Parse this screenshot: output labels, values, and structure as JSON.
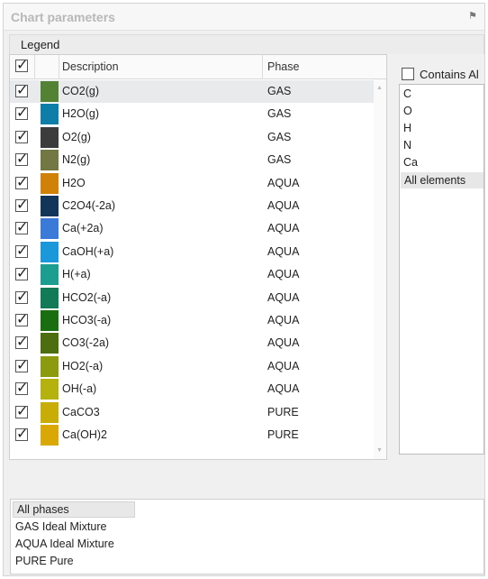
{
  "panel": {
    "title": "Chart parameters",
    "pin_glyph": "⚑"
  },
  "legend": {
    "label": "Legend"
  },
  "grid": {
    "columns": {
      "description": "Description",
      "phase": "Phase"
    },
    "rows": [
      {
        "description": "CO2(g)",
        "phase": "GAS",
        "color": "#548235"
      },
      {
        "description": "H2O(g)",
        "phase": "GAS",
        "color": "#0e7ea8"
      },
      {
        "description": "O2(g)",
        "phase": "GAS",
        "color": "#3c3c3c"
      },
      {
        "description": "N2(g)",
        "phase": "GAS",
        "color": "#727744"
      },
      {
        "description": "H2O",
        "phase": "AQUA",
        "color": "#d08108"
      },
      {
        "description": "C2O4(-2a)",
        "phase": "AQUA",
        "color": "#12365a"
      },
      {
        "description": "Ca(+2a)",
        "phase": "AQUA",
        "color": "#3b7ad8"
      },
      {
        "description": "CaOH(+a)",
        "phase": "AQUA",
        "color": "#1a98d9"
      },
      {
        "description": "H(+a)",
        "phase": "AQUA",
        "color": "#1b9e90"
      },
      {
        "description": "HCO2(-a)",
        "phase": "AQUA",
        "color": "#127a57"
      },
      {
        "description": "HCO3(-a)",
        "phase": "AQUA",
        "color": "#1b6e10"
      },
      {
        "description": "CO3(-2a)",
        "phase": "AQUA",
        "color": "#4e6d10"
      },
      {
        "description": "HO2(-a)",
        "phase": "AQUA",
        "color": "#8c9a0f"
      },
      {
        "description": "OH(-a)",
        "phase": "AQUA",
        "color": "#b5b10f"
      },
      {
        "description": "CaCO3",
        "phase": "PURE",
        "color": "#c8ad06"
      },
      {
        "description": "Ca(OH)2",
        "phase": "PURE",
        "color": "#d9a807"
      }
    ]
  },
  "elements": {
    "contains_all_label": "Contains Al",
    "items": [
      "C",
      "O",
      "H",
      "N",
      "Ca"
    ],
    "all_label": "All elements"
  },
  "phases": {
    "all_label": "All phases",
    "items": [
      "GAS Ideal Mixture",
      "AQUA Ideal Mixture",
      "PURE Pure"
    ]
  }
}
